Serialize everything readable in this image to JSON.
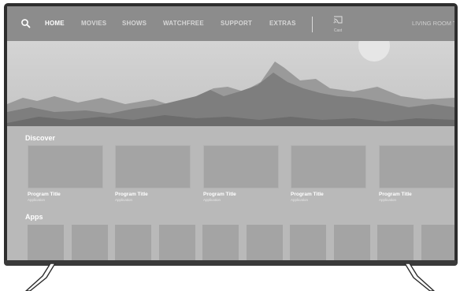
{
  "nav": {
    "items": [
      {
        "label": "HOME",
        "active": true
      },
      {
        "label": "MOVIES",
        "active": false
      },
      {
        "label": "SHOWS",
        "active": false
      },
      {
        "label": "WATCHFREE",
        "active": false
      },
      {
        "label": "SUPPORT",
        "active": false
      },
      {
        "label": "EXTRAS",
        "active": false
      }
    ],
    "cast_label": "Cast",
    "device_name": "LIVING ROOM TV",
    "search_icon": "search-icon",
    "cast_icon": "cast-icon"
  },
  "discover": {
    "title": "Discover",
    "cards": [
      {
        "title": "Program Title",
        "subtitle": "Application"
      },
      {
        "title": "Program Title",
        "subtitle": "Application"
      },
      {
        "title": "Program Title",
        "subtitle": "Application"
      },
      {
        "title": "Program Title",
        "subtitle": "Application"
      },
      {
        "title": "Program Title",
        "subtitle": "Application"
      }
    ]
  },
  "apps": {
    "title": "Apps",
    "tile_count": 10
  },
  "colors": {
    "nav_background": "#8c8c8c",
    "screen_background": "#b9b9b9",
    "tile": "#a4a4a4",
    "bezel": "#2e2e2e"
  }
}
